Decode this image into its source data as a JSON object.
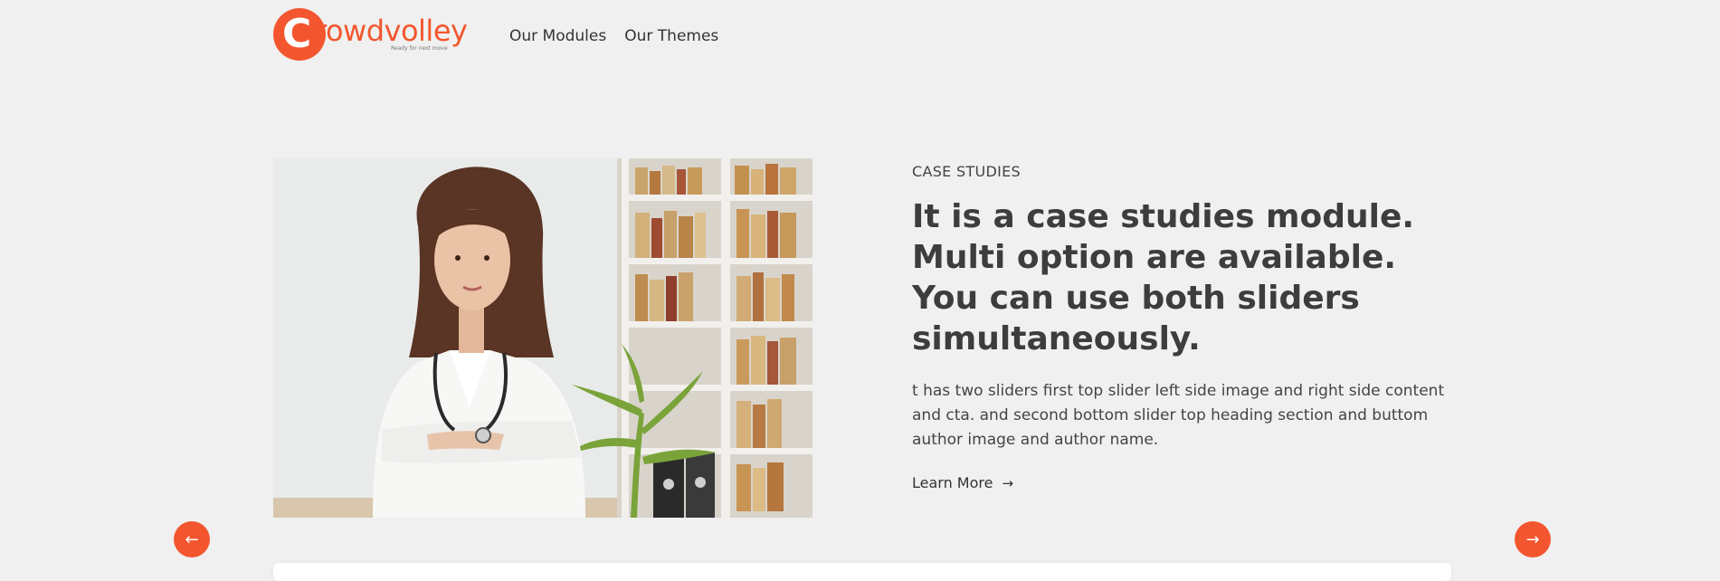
{
  "brand": {
    "logo_letter": "C",
    "logo_word": "rowdvolley",
    "tagline": "Ready for next move",
    "color": "#f3562f"
  },
  "nav": {
    "items": [
      {
        "label": "Our Modules"
      },
      {
        "label": "Our Themes"
      }
    ]
  },
  "slide": {
    "eyebrow": "CASE STUDIES",
    "heading": "It is a case studies module. Multi option are available. You can use both sliders simultaneously.",
    "description": "t has two sliders first top slider left side image and right side content and cta. and second bottom slider top heading section and buttom author image and author name.",
    "cta_label": "Learn More",
    "cta_icon": "arrow-right-icon",
    "image_subject": "doctor-photo"
  },
  "controls": {
    "prev_icon": "arrow-left-icon",
    "next_icon": "arrow-right-icon",
    "prev_glyph": "←",
    "next_glyph": "→",
    "cta_glyph": "→"
  }
}
